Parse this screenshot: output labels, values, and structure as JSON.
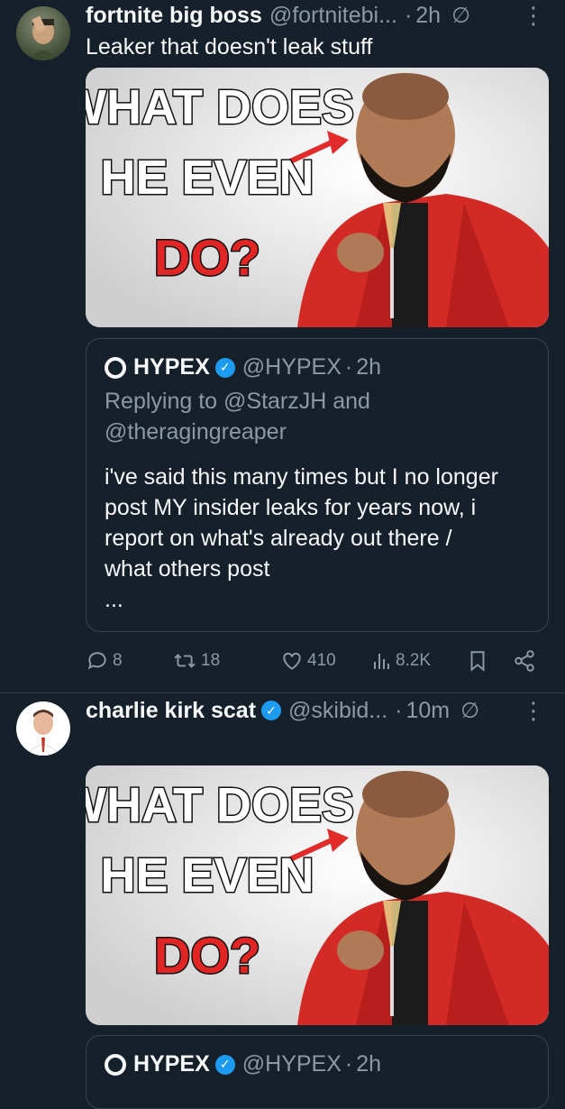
{
  "tweets": [
    {
      "author": {
        "name": "fortnite big boss",
        "handle": "@fortnitebi..."
      },
      "time": "2h",
      "text": "Leaker that doesn't leak stuff",
      "media": {
        "lines": [
          "WHAT DOES",
          "HE EVEN",
          "DO?"
        ]
      },
      "quote": {
        "name": "HYPEX",
        "handle": "@HYPEX",
        "time": "2h",
        "reply_line1": "Replying to @StarzJH and",
        "reply_line2": "@theragingreaper",
        "body_lines": [
          "i've said this many times but I no longer",
          "post MY insider leaks for years now, i",
          "report on what's already out there /",
          "what others post"
        ],
        "more": "..."
      },
      "stats": {
        "replies": "8",
        "reposts": "18",
        "likes": "410",
        "views": "8.2K"
      }
    },
    {
      "author": {
        "name": "charlie kirk scat",
        "handle": "@skibid..."
      },
      "time": "10m",
      "media": {
        "lines": [
          "WHAT DOES",
          "HE EVEN",
          "DO?"
        ]
      },
      "quote": {
        "name": "HYPEX",
        "handle": "@HYPEX",
        "time": "2h"
      }
    }
  ],
  "ui": {
    "dot": "·",
    "more_icon": "⋮",
    "grok_icon": "∅"
  },
  "colors": {
    "background": "#15202b",
    "text": "#f7f9f9",
    "muted": "#8b98a5",
    "verified": "#1d9bf0",
    "border": "#38444d"
  }
}
